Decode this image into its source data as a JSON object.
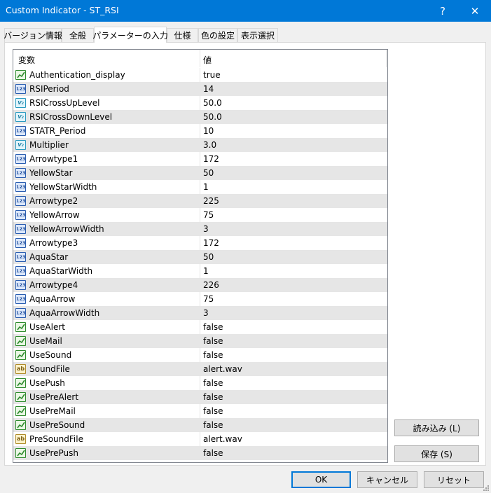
{
  "window": {
    "title": "Custom Indicator - ST_RSI",
    "help_icon": "?",
    "close_icon": "✕"
  },
  "tabs": [
    {
      "label": "バージョン情報"
    },
    {
      "label": "全般"
    },
    {
      "label": "パラメーターの入力"
    },
    {
      "label": "仕様"
    },
    {
      "label": "色の設定"
    },
    {
      "label": "表示選択"
    }
  ],
  "active_tab": 2,
  "grid": {
    "col_variable": "変数",
    "col_value": "値",
    "rows": [
      {
        "type": "bool",
        "name": "Authentication_display",
        "value": "true"
      },
      {
        "type": "int",
        "name": "RSIPeriod",
        "value": "14"
      },
      {
        "type": "dbl",
        "name": "RSICrossUpLevel",
        "value": "50.0"
      },
      {
        "type": "dbl",
        "name": "RSICrossDownLevel",
        "value": "50.0"
      },
      {
        "type": "int",
        "name": "STATR_Period",
        "value": "10"
      },
      {
        "type": "dbl",
        "name": "Multiplier",
        "value": "3.0"
      },
      {
        "type": "int",
        "name": "Arrowtype1",
        "value": "172"
      },
      {
        "type": "int",
        "name": "YellowStar",
        "value": "50"
      },
      {
        "type": "int",
        "name": "YellowStarWidth",
        "value": "1"
      },
      {
        "type": "int",
        "name": "Arrowtype2",
        "value": "225"
      },
      {
        "type": "int",
        "name": "YellowArrow",
        "value": "75"
      },
      {
        "type": "int",
        "name": "YellowArrowWidth",
        "value": "3"
      },
      {
        "type": "int",
        "name": "Arrowtype3",
        "value": "172"
      },
      {
        "type": "int",
        "name": "AquaStar",
        "value": "50"
      },
      {
        "type": "int",
        "name": "AquaStarWidth",
        "value": "1"
      },
      {
        "type": "int",
        "name": "Arrowtype4",
        "value": "226"
      },
      {
        "type": "int",
        "name": "AquaArrow",
        "value": "75"
      },
      {
        "type": "int",
        "name": "AquaArrowWidth",
        "value": "3"
      },
      {
        "type": "bool",
        "name": "UseAlert",
        "value": "false"
      },
      {
        "type": "bool",
        "name": "UseMail",
        "value": "false"
      },
      {
        "type": "bool",
        "name": "UseSound",
        "value": "false"
      },
      {
        "type": "str",
        "name": "SoundFile",
        "value": "alert.wav"
      },
      {
        "type": "bool",
        "name": "UsePush",
        "value": "false"
      },
      {
        "type": "bool",
        "name": "UsePreAlert",
        "value": "false"
      },
      {
        "type": "bool",
        "name": "UsePreMail",
        "value": "false"
      },
      {
        "type": "bool",
        "name": "UsePreSound",
        "value": "false"
      },
      {
        "type": "str",
        "name": "PreSoundFile",
        "value": "alert.wav"
      },
      {
        "type": "bool",
        "name": "UsePrePush",
        "value": "false"
      }
    ]
  },
  "icon_labels": {
    "int": "123",
    "dbl": "V₂",
    "str": "ab"
  },
  "buttons": {
    "load": "読み込み (L)",
    "save": "保存 (S)",
    "ok": "OK",
    "cancel": "キャンセル",
    "reset": "リセット"
  },
  "colors": {
    "titlebar": "#0078d7",
    "alt_row": "#e6e6e6",
    "bool_icon": "#2e8b2e",
    "int_icon": "#2a5db0"
  }
}
